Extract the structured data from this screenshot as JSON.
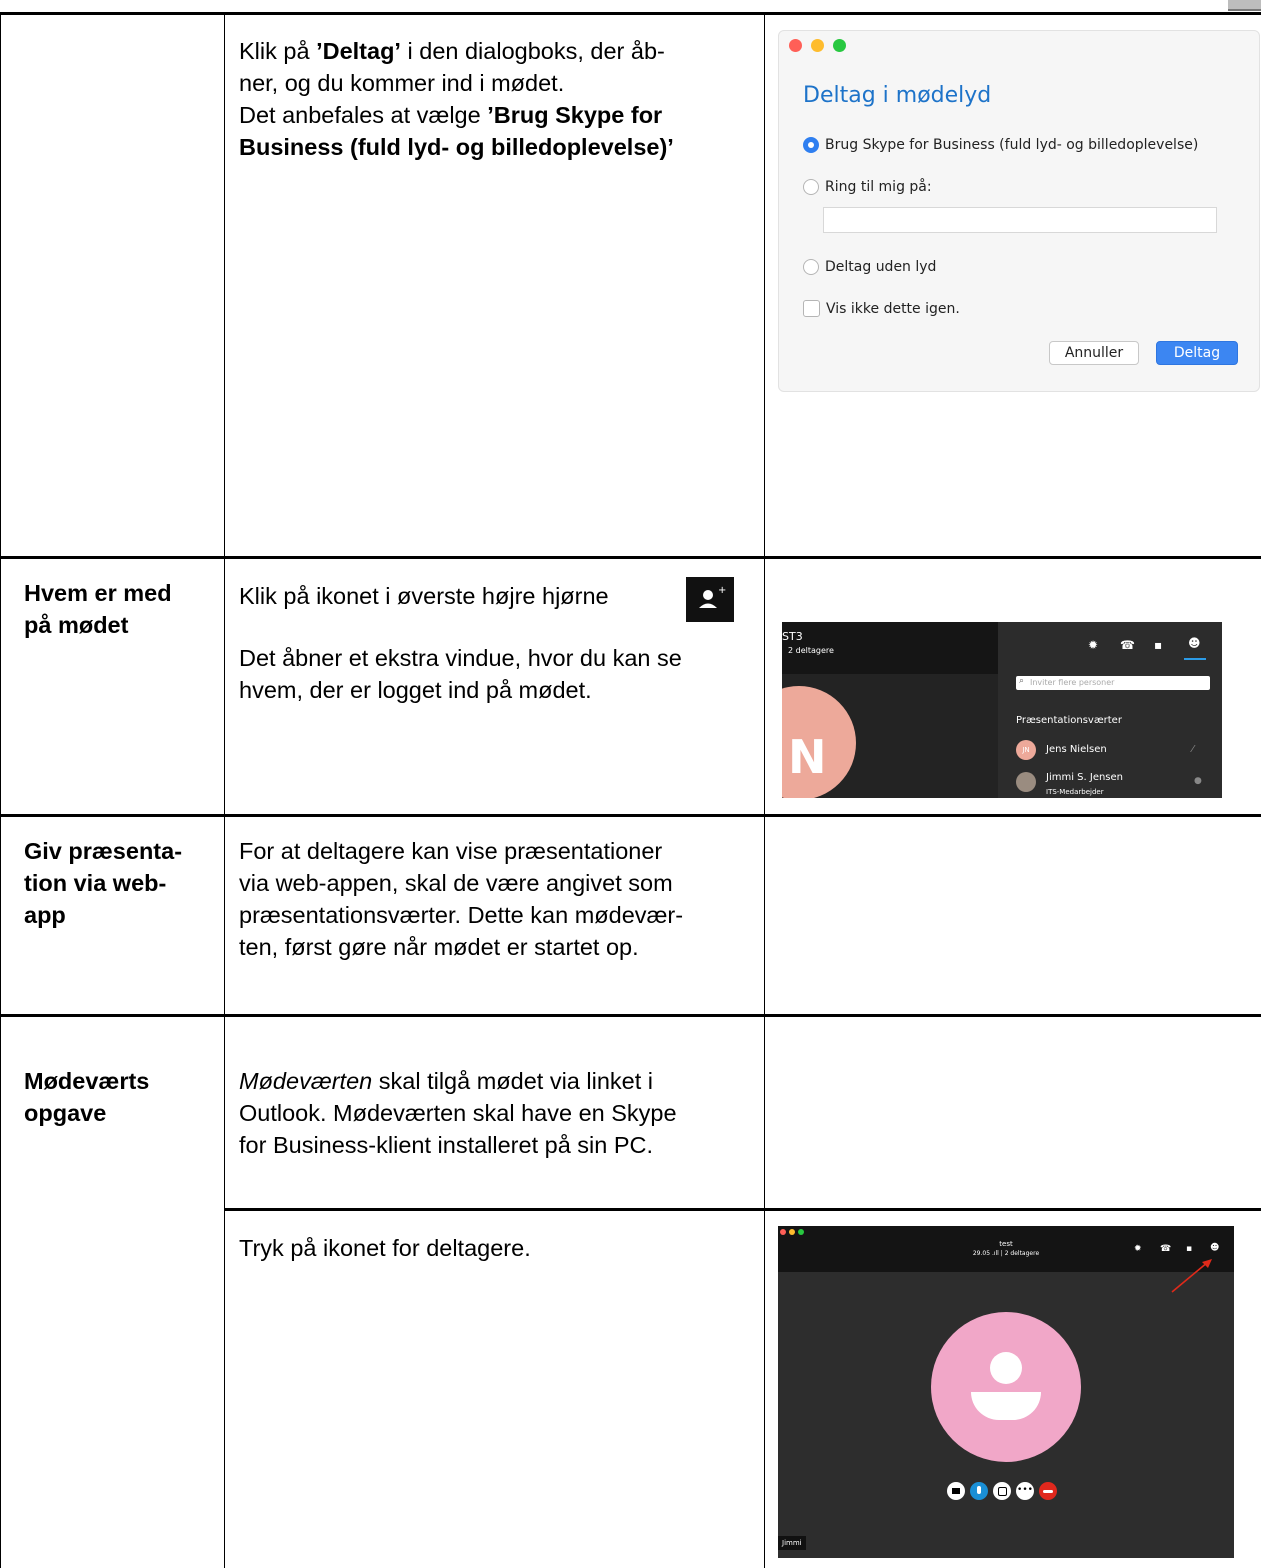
{
  "rows": [
    {
      "label": "",
      "lines": [
        [
          {
            "t": "Klik på "
          },
          {
            "t": "’Deltag’",
            "b": true
          },
          {
            "t": " i den dialogboks, der åb-"
          }
        ],
        [
          {
            "t": "ner, og du kommer ind i mødet."
          }
        ],
        [
          {
            "t": "Det anbefales at vælge "
          },
          {
            "t": "’Brug Skype for",
            "b": true
          }
        ],
        [
          {
            "t": "Business (fuld lyd- og billedoplevelse)’",
            "b": true
          }
        ]
      ]
    },
    {
      "label_lines": [
        "Hvem er med",
        "på mødet"
      ],
      "line1": "Klik på ikonet i øverste højre hjørne",
      "para2": [
        "Det åbner et ekstra vindue, hvor du kan se",
        "hvem, der er logget ind på mødet."
      ]
    },
    {
      "label_lines": [
        "Giv præsenta-",
        "tion via web-",
        "app"
      ],
      "para": [
        "For at deltagere kan vise præsentationer",
        "via web-appen, skal de være angivet som",
        "præsentationsværter. Dette kan mødevær-",
        "ten, først gøre når mødet er startet op."
      ]
    },
    {
      "label_lines": [
        "Mødeværts",
        "opgave"
      ],
      "para_italic_start": "Mødeværten",
      "para_rest_first": " skal tilgå mødet via linket i",
      "para": [
        "Outlook. Mødeværten skal have en Skype",
        "for Business-klient installeret på sin PC."
      ],
      "sub_text": "Tryk på ikonet for deltagere."
    }
  ],
  "dialog": {
    "title": "Deltag i mødelyd",
    "option1": "Brug Skype for Business (fuld lyd- og billedoplevelse)",
    "option2": "Ring til mig på:",
    "option3": "Deltag uden lyd",
    "checkbox": "Vis ikke dette igen.",
    "cancel": "Annuller",
    "join": "Deltag",
    "colors": {
      "red": "#ff5f57",
      "yellow": "#febc2e",
      "green": "#28c840",
      "accent": "#1d73c9"
    }
  },
  "participants_panel": {
    "meeting_title_fragment": "ST3",
    "participants_count": "2 deltagere",
    "avatar_letter": "N",
    "search_placeholder": "Inviter flere personer",
    "section": "Præsentationsværter",
    "p1_initials": "JN",
    "p1_name": "Jens Nielsen",
    "p2_name": "Jimmi S. Jensen",
    "p2_role": "ITS-Medarbejder"
  },
  "meeting_window": {
    "title": "test",
    "status": "29.05 .ıll | 2 deltagere",
    "name_tag": "Jimmi"
  }
}
